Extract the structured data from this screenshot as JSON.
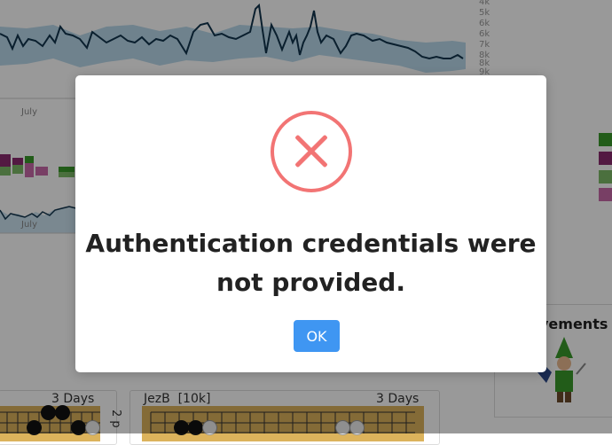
{
  "background": {
    "chart_top": {
      "y_tick_labels": [
        "4k",
        "5k",
        "6k",
        "6k",
        "7k",
        "8k",
        "8k",
        "9k"
      ],
      "x_tick_label": "July"
    },
    "chart_mid": {
      "x_tick_label": "July"
    },
    "game_cards": [
      {
        "left_label": "",
        "time_label": "3 Days"
      },
      {
        "left_label": "JezB  [10k]",
        "time_label": "3 Days"
      }
    ],
    "side_vertical_text": "2 p",
    "achievements": {
      "title": "vements",
      "icon": "gnome-character-icon"
    },
    "colors": {
      "line": "#12344d",
      "band": "#a8d0e6",
      "green": "#3a9a2a",
      "purple": "#8a2a6e",
      "lightgreen": "#7dbb68",
      "pink": "#c96aa8",
      "board": "#dcb35c"
    }
  },
  "modal": {
    "icon": "error-x-icon",
    "icon_color": "#f27474",
    "message": "Authentication credentials were not provided.",
    "ok_label": "OK",
    "ok_color": "#3f96f2"
  }
}
